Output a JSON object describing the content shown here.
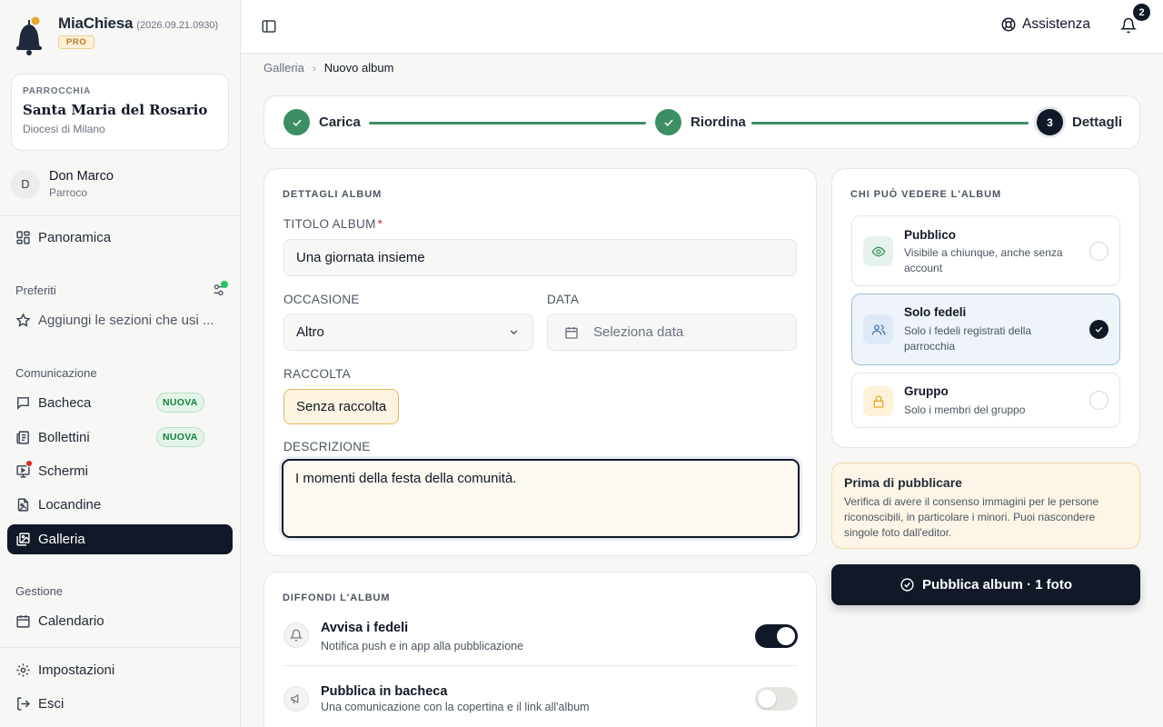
{
  "app": {
    "name": "MiaChiesa",
    "version": "(2026.09.21.0930)",
    "plan": "PRO"
  },
  "parish": {
    "label": "PARROCCHIA",
    "name": "Santa Maria del Rosario",
    "diocese": "Diocesi di Milano"
  },
  "user": {
    "initial": "D",
    "name": "Don Marco",
    "role": "Parroco"
  },
  "nav": {
    "overview": "Panoramica",
    "favorites_title": "Preferiti",
    "favorites_add": "Aggiungi le sezioni che usi ...",
    "comm_title": "Comunicazione",
    "comm_items": [
      {
        "label": "Bacheca",
        "badge": "NUOVA"
      },
      {
        "label": "Bollettini",
        "badge": "NUOVA"
      },
      {
        "label": "Schermi"
      },
      {
        "label": "Locandine"
      },
      {
        "label": "Galleria",
        "active": true
      }
    ],
    "mgmt_title": "Gestione",
    "mgmt_items": [
      {
        "label": "Calendario"
      }
    ],
    "settings": "Impostazioni",
    "logout": "Esci"
  },
  "header": {
    "help": "Assistenza",
    "notifications": "2"
  },
  "breadcrumb": {
    "parent": "Galleria",
    "current": "Nuovo album"
  },
  "steps": [
    {
      "number": "1",
      "label": "Carica",
      "status": "done"
    },
    {
      "number": "2",
      "label": "Riordina",
      "status": "done"
    },
    {
      "number": "3",
      "label": "Dettagli",
      "status": "current"
    }
  ],
  "details": {
    "section_title": "DETTAGLI ALBUM",
    "title_label": "TITOLO ALBUM",
    "title_required": "*",
    "title_value": "Una giornata insieme",
    "occasion_label": "OCCASIONE",
    "occasion_value": "Altro",
    "date_label": "DATA",
    "date_placeholder": "Seleziona data",
    "collection_label": "RACCOLTA",
    "collection_value": "Senza raccolta",
    "description_label": "DESCRIZIONE",
    "description_value": "I momenti della festa della comunità."
  },
  "share": {
    "section_title": "DIFFONDI L'ALBUM",
    "items": [
      {
        "title": "Avvisa i fedeli",
        "desc": "Notifica push e in app alla pubblicazione",
        "enabled": true
      },
      {
        "title": "Pubblica in bacheca",
        "desc": "Una comunicazione con la copertina e il link all'album",
        "enabled": false
      }
    ]
  },
  "visibility": {
    "section_title": "CHI PUÒ VEDERE L'ALBUM",
    "options": [
      {
        "title": "Pubblico",
        "desc": "Visibile a chiunque, anche senza account",
        "icon": "eye-icon",
        "selected": false
      },
      {
        "title": "Solo fedeli",
        "desc": "Solo i fedeli registrati della parrocchia",
        "icon": "users-icon",
        "selected": true
      },
      {
        "title": "Gruppo",
        "desc": "Solo i membri del gruppo",
        "icon": "lock-icon",
        "selected": false
      }
    ]
  },
  "notice": {
    "title": "Prima di pubblicare",
    "text": "Verifica di avere il consenso immagini per le persone riconoscibili, in particolare i minori. Puoi nascondere singole foto dall'editor."
  },
  "publish_button": "Pubblica album · 1 foto",
  "colors": {
    "primary": "#111827",
    "success": "#3b8f63",
    "accent_amber": "#e6b45c",
    "badge_green": "#15803d",
    "danger": "#dc2626"
  }
}
